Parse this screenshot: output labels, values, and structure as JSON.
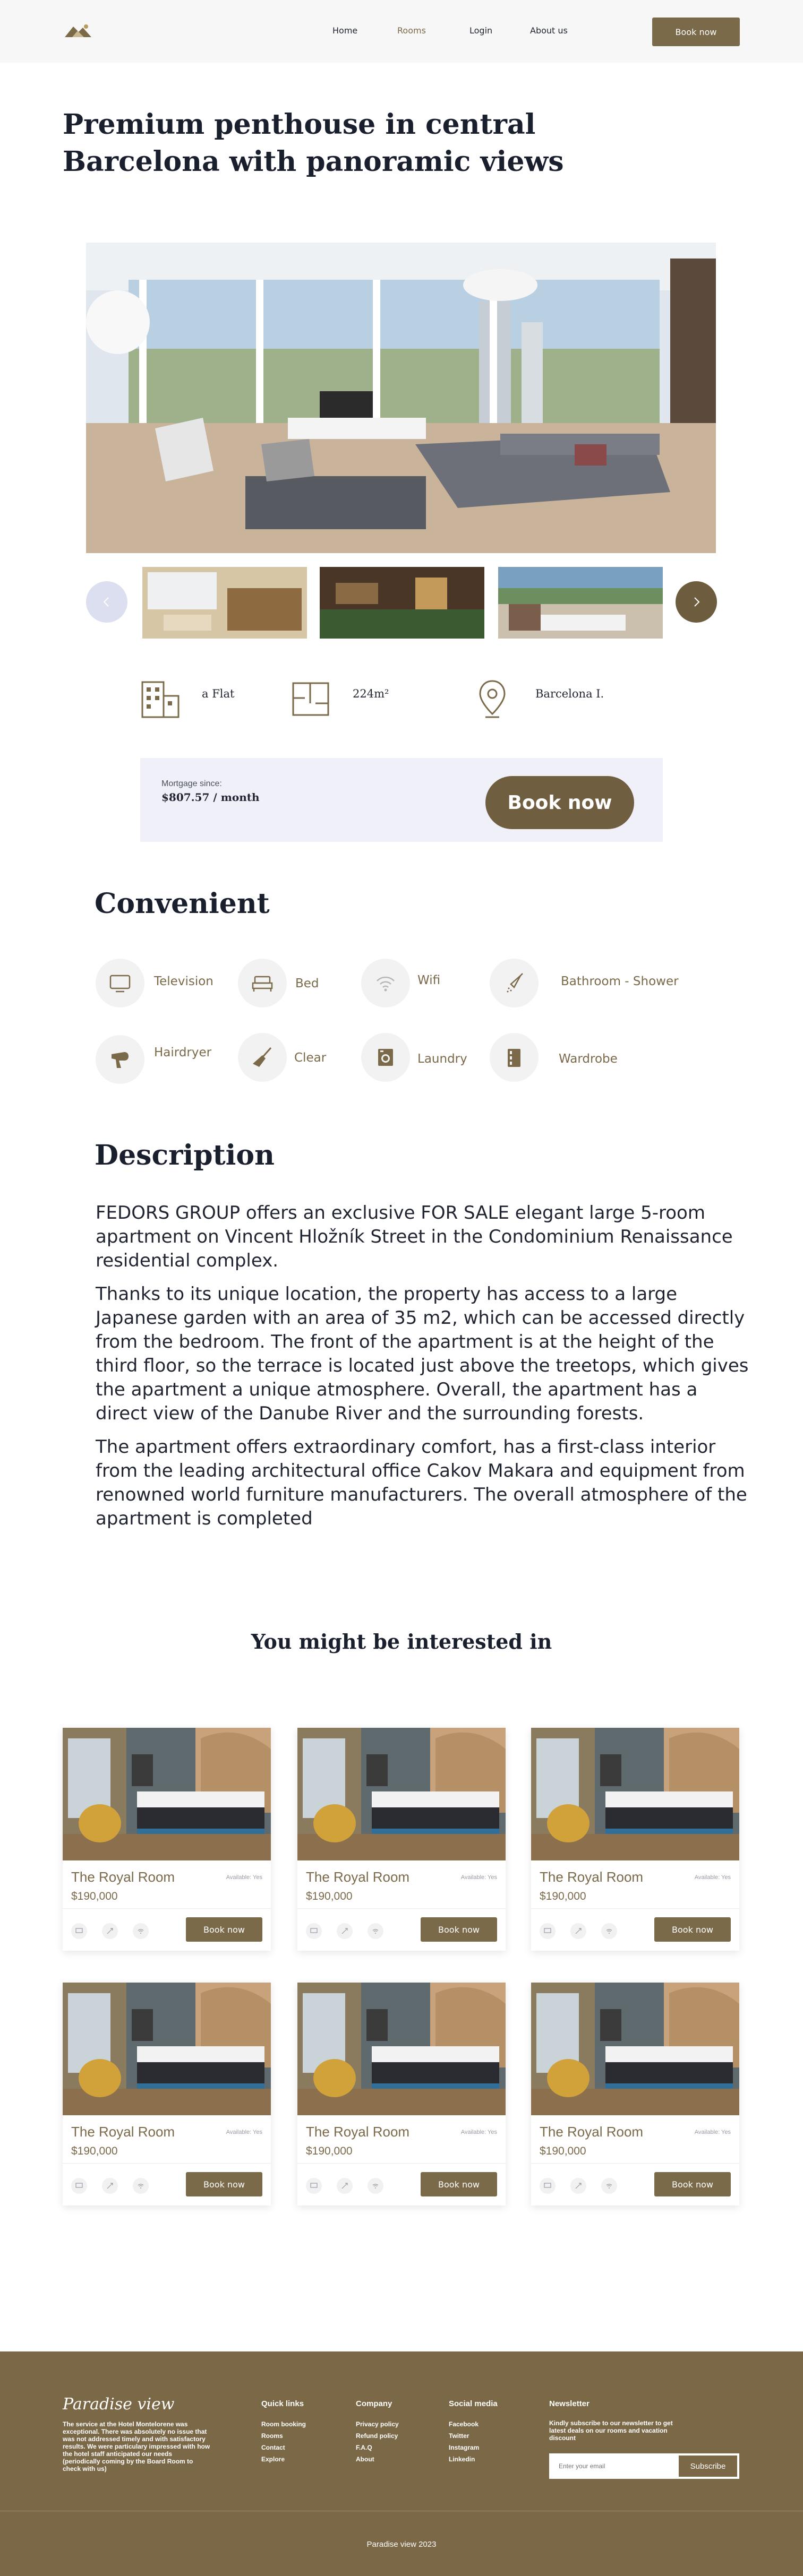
{
  "header": {
    "nav": [
      "Home",
      "Rooms",
      "Login",
      "About us"
    ],
    "book_label": "Book now"
  },
  "listing": {
    "title": "Premium penthouse in central Barcelona with panoramic views",
    "features": {
      "type": "a Flat",
      "area": "224m²",
      "location": "Barcelona I."
    },
    "mortgage_label": "Mortgage since:",
    "mortgage_value": "$807.57 / month",
    "book_label": "Book now"
  },
  "amenities": {
    "title": "Convenient",
    "items": [
      {
        "label": "Television",
        "icon": "tv-icon"
      },
      {
        "label": "Bed",
        "icon": "bed-icon"
      },
      {
        "label": "Wifi",
        "icon": "wifi-icon"
      },
      {
        "label": "Bathroom - Shower",
        "icon": "shower-icon"
      },
      {
        "label": "Hairdryer",
        "icon": "hairdryer-icon"
      },
      {
        "label": "Clear",
        "icon": "broom-icon"
      },
      {
        "label": "Laundry",
        "icon": "washing-machine-icon"
      },
      {
        "label": "Wardrobe",
        "icon": "wardrobe-icon"
      }
    ]
  },
  "description": {
    "title": "Description",
    "paragraphs": [
      "FEDORS GROUP offers an exclusive FOR SALE elegant large 5-room apartment on Vincent Hložník Street in the Condominium Renaissance residential complex.",
      "Thanks to its unique location, the property has access to a large Japanese garden with an area of 35 m2, which can be accessed directly from the bedroom. The front of the apartment is at the height of the third floor, so the terrace is located just above the treetops, which gives the apartment a unique atmosphere. Overall, the apartment has a direct view of the Danube River and the surrounding forests.",
      "The apartment offers extraordinary comfort, has a first-class interior from the leading architectural office Cakov Makara and equipment from renowned world furniture manufacturers. The overall atmosphere of the apartment is completed"
    ]
  },
  "related": {
    "title": "You might be interested in",
    "cards": [
      {
        "name": "The Royal Room",
        "avail": "Available: Yes",
        "price": "$190,000",
        "button": "Book now"
      },
      {
        "name": "The Royal Room",
        "avail": "Available: Yes",
        "price": "$190,000",
        "button": "Book now"
      },
      {
        "name": "The Royal Room",
        "avail": "Available: Yes",
        "price": "$190,000",
        "button": "Book now"
      },
      {
        "name": "The Royal Room",
        "avail": "Available: Yes",
        "price": "$190,000",
        "button": "Book now"
      },
      {
        "name": "The Royal Room",
        "avail": "Available: Yes",
        "price": "$190,000",
        "button": "Book now"
      },
      {
        "name": "The Royal Room",
        "avail": "Available: Yes",
        "price": "$190,000",
        "button": "Book now"
      }
    ]
  },
  "footer": {
    "brand": "Paradise view",
    "about": "The service at the Hotel Montelorene was exceptional. There was absolutely no issue that was not addressed timely and with satisfactory results. We were particulary impressed with how the hotel staff anticipated our needs (periodically coming by the Board Room to check with us)",
    "quick_links": {
      "title": "Quick links",
      "items": [
        "Room booking",
        "Rooms",
        "Contact",
        "Explore"
      ]
    },
    "company": {
      "title": "Company",
      "items": [
        "Privacy policy",
        "Refund policy",
        "F.A.Q",
        "About"
      ]
    },
    "social": {
      "title": "Social media",
      "items": [
        "Facebook",
        "Twitter",
        "Instagram",
        "Linkedin"
      ]
    },
    "newsletter": {
      "title": "Newsletter",
      "text": "Kindly subscribe to our newsletter to get latest deals on our rooms and vacation discount",
      "placeholder": "Enter your email",
      "button": "Subscribe"
    },
    "copyright": "Paradise view 2023"
  },
  "colors": {
    "brand": "#7a6a4a",
    "mortgage_bg": "#f0f1f8",
    "footer_bg": "#7a6846"
  }
}
